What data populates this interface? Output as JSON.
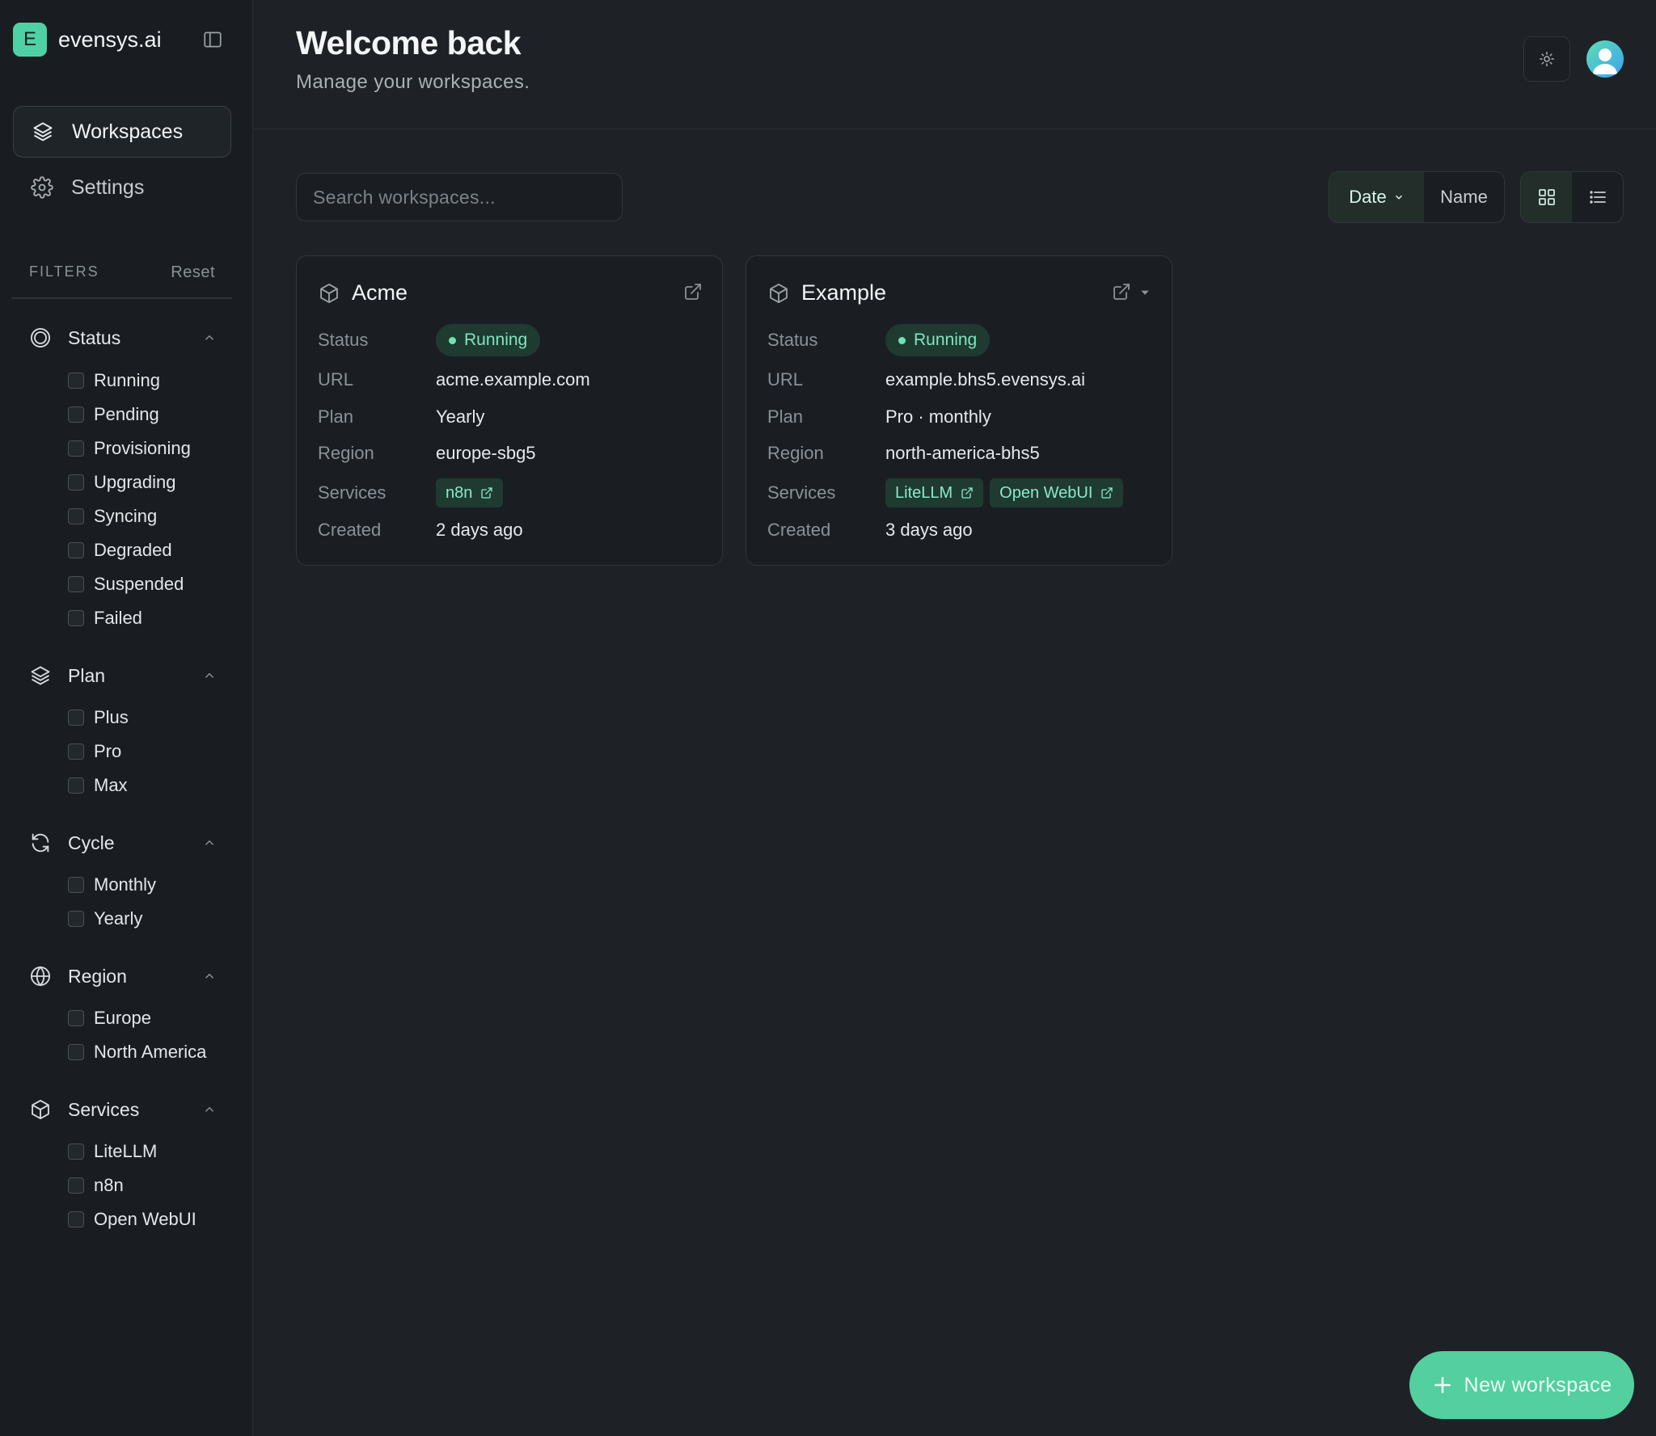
{
  "brand": {
    "initial": "E",
    "name": "evensys.ai"
  },
  "nav": [
    {
      "label": "Workspaces",
      "icon": "layers-icon",
      "active": true
    },
    {
      "label": "Settings",
      "icon": "gear-icon",
      "active": false
    }
  ],
  "filters": {
    "title": "FILTERS",
    "reset": "Reset",
    "groups": [
      {
        "label": "Status",
        "icon": "status-icon",
        "options": [
          "Running",
          "Pending",
          "Provisioning",
          "Upgrading",
          "Syncing",
          "Degraded",
          "Suspended",
          "Failed"
        ]
      },
      {
        "label": "Plan",
        "icon": "layers-icon",
        "options": [
          "Plus",
          "Pro",
          "Max"
        ]
      },
      {
        "label": "Cycle",
        "icon": "refresh-icon",
        "options": [
          "Monthly",
          "Yearly"
        ]
      },
      {
        "label": "Region",
        "icon": "globe-icon",
        "options": [
          "Europe",
          "North America"
        ]
      },
      {
        "label": "Services",
        "icon": "box-icon",
        "options": [
          "LiteLLM",
          "n8n",
          "Open WebUI"
        ]
      }
    ]
  },
  "header": {
    "title": "Welcome back",
    "subtitle": "Manage your workspaces."
  },
  "search": {
    "placeholder": "Search workspaces...",
    "value": ""
  },
  "sort": {
    "date_label": "Date",
    "name_label": "Name",
    "active": "Date"
  },
  "view": {
    "active": "grid"
  },
  "field_labels": {
    "status": "Status",
    "url": "URL",
    "plan": "Plan",
    "region": "Region",
    "services": "Services",
    "created": "Created"
  },
  "workspaces": [
    {
      "name": "Acme",
      "status": "Running",
      "url": "acme.example.com",
      "plan": "Yearly",
      "region": "europe-sbg5",
      "services": [
        "n8n"
      ],
      "created": "2 days ago"
    },
    {
      "name": "Example",
      "status": "Running",
      "url": "example.bhs5.evensys.ai",
      "plan": "Pro · monthly",
      "region": "north-america-bhs5",
      "services": [
        "LiteLLM",
        "Open WebUI"
      ],
      "created": "3 days ago"
    }
  ],
  "fab": {
    "label": "New workspace"
  },
  "colors": {
    "accent": "#54cf9f",
    "pill_bg": "#1f3a31",
    "pill_text": "#7fe6c0",
    "background": "#1e2226",
    "sidebar": "#191d21"
  }
}
